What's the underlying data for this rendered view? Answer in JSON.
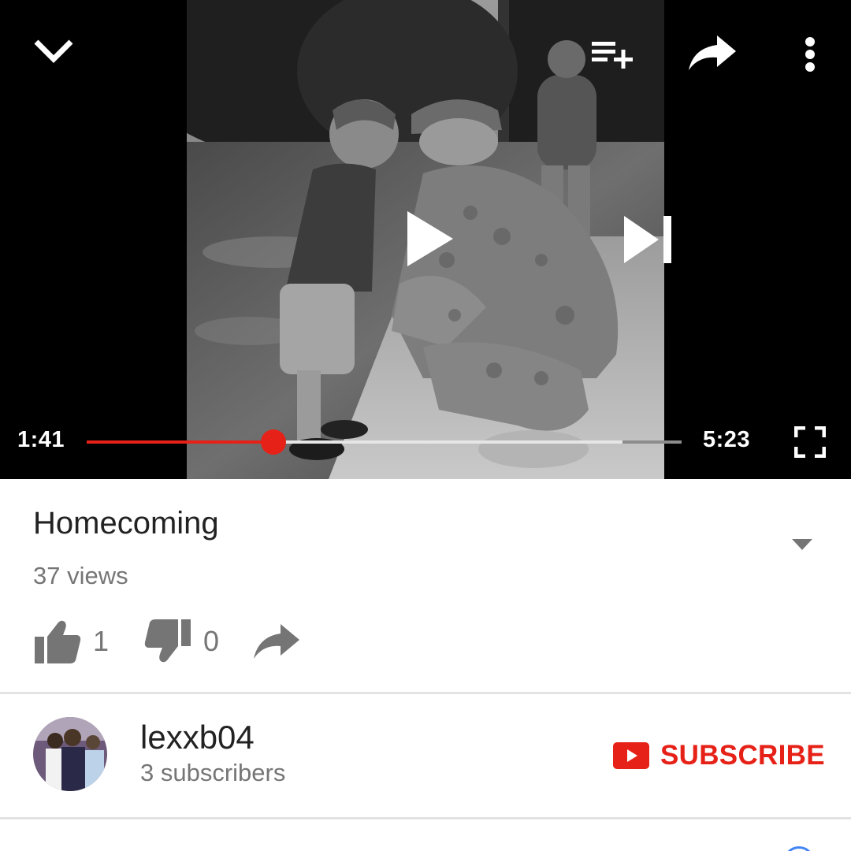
{
  "player": {
    "time_current": "1:41",
    "time_total": "5:23",
    "progress_played": 0.3134,
    "progress_buffered": 0.9,
    "icons": {
      "collapse": "chevron-down-icon",
      "add_to_queue": "playlist-add-icon",
      "share": "share-icon",
      "more": "more-vert-icon",
      "play": "play-icon",
      "next": "skip-next-icon",
      "fullscreen": "fullscreen-icon"
    }
  },
  "video": {
    "title": "Homecoming",
    "views": "37 views",
    "likes": "1",
    "dislikes": "0"
  },
  "channel": {
    "name": "lexxb04",
    "subscribers": "3 subscribers",
    "subscribe_label": "SUBSCRIBE"
  },
  "colors": {
    "accent": "#e62117",
    "text_primary": "#222222",
    "text_secondary": "#767676"
  }
}
